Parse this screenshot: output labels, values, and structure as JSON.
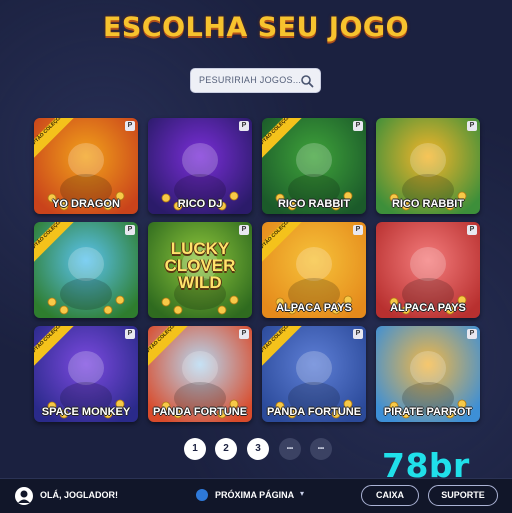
{
  "header": {
    "title": "ESCOLHA SEU JOGO"
  },
  "search": {
    "placeholder": "PESURIRIAH JOGOS...",
    "icon": "search-icon"
  },
  "games": [
    {
      "name": "YO DRAGON",
      "ribbon": "CAPTÃO COLEÇÕES",
      "badge": "P",
      "colors": [
        "#f2a21b",
        "#c9431b"
      ]
    },
    {
      "name": "RICO DJ",
      "badge": "P",
      "colors": [
        "#7a2ed8",
        "#2b1b6a"
      ]
    },
    {
      "name": "RICO RABBIT",
      "ribbon": "CAPTÃO COLEÇÕES",
      "badge": "P",
      "colors": [
        "#3fa33a",
        "#1b5a2a"
      ]
    },
    {
      "name": "RICO RABBIT",
      "badge": "P",
      "colors": [
        "#f5b52a",
        "#3d8f3a"
      ]
    },
    {
      "name": "",
      "ribbon": "CAPTÃO COLEÇÕES",
      "badge": "P",
      "colors": [
        "#5bc3f0",
        "#2e7d2e"
      ]
    },
    {
      "name": "",
      "bigname": "LUCKY CLOVER WILD",
      "badge": "P",
      "colors": [
        "#8ec63b",
        "#2f6b1f"
      ]
    },
    {
      "name": "ALPACA PAYS",
      "ribbon": "CAPTÃO COLEÇÕES",
      "badge": "P",
      "colors": [
        "#f6c23a",
        "#e58a1b"
      ]
    },
    {
      "name": "ALPACA PAYS",
      "badge": "P",
      "colors": [
        "#f47c7c",
        "#b8302f"
      ]
    },
    {
      "name": "SPACE MONKEY",
      "ribbon": "CAPTÃO COLEÇÕES",
      "badge": "P",
      "colors": [
        "#7c4ae0",
        "#2a2a8a"
      ]
    },
    {
      "name": "PANDA FORTUNE",
      "ribbon": "CAPTÃO COLEÇÕES",
      "badge": "P",
      "colors": [
        "#b6d9f2",
        "#d94b2b"
      ]
    },
    {
      "name": "PANDA FORTUNE",
      "ribbon": "CAPTÃO COLEÇÕES",
      "badge": "P",
      "colors": [
        "#5e7fd6",
        "#2b4a9a"
      ]
    },
    {
      "name": "PIRATE PARROT",
      "badge": "P",
      "colors": [
        "#f4b845",
        "#3d8fd6"
      ]
    }
  ],
  "pagination": {
    "pages": [
      "1",
      "2",
      "3",
      "...",
      "..."
    ],
    "current": "3"
  },
  "brand": "78br",
  "footer": {
    "greeting": "OLÁ, JOGLADOR!",
    "next_label": "PRÓXIMA PÁGINA",
    "caixa_label": "CAIXA",
    "suporte_label": "SUPORTE"
  }
}
